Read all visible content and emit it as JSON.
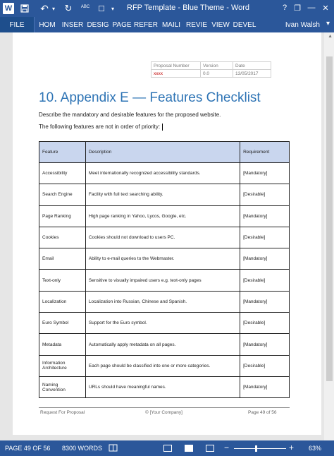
{
  "window": {
    "title": "RFP Template - Blue Theme - Word",
    "help_icon": "?",
    "minimize_icon": "—",
    "restore_icon": "❐",
    "close_icon": "✕"
  },
  "quick_access": {
    "app_icon": "W",
    "save_icon": "💾",
    "undo_icon": "↶",
    "undo_menu_icon": "▾",
    "redo_icon": "↻",
    "spelling_icon": "ABC",
    "format_icon": "☐",
    "more_icon": "▾"
  },
  "ribbon": {
    "tabs": [
      {
        "label": "FILE"
      },
      {
        "label": "HOM"
      },
      {
        "label": "INSER"
      },
      {
        "label": "DESIG"
      },
      {
        "label": "PAGE"
      },
      {
        "label": "REFER"
      },
      {
        "label": "MAILI"
      },
      {
        "label": "REVIE"
      },
      {
        "label": "VIEW"
      },
      {
        "label": "DEVEL"
      }
    ],
    "user": "Ivan Walsh",
    "user_caret": "▾"
  },
  "header_table": {
    "labels": [
      "Proposal Number",
      "Version",
      "Date"
    ],
    "values": [
      "xxxx",
      "0.0",
      "13/05/2017"
    ]
  },
  "document": {
    "heading": "10. Appendix E — Features Checklist",
    "intro": "Describe the mandatory and desirable features for the proposed website.",
    "note": "The following features are not in order of priority:"
  },
  "features_table": {
    "headers": [
      "Feature",
      "Description",
      "Requirement"
    ],
    "rows": [
      {
        "feature": "Accessibility",
        "description": "Meet internationally recognized accessibility standards.",
        "requirement": "[Mandatory]"
      },
      {
        "feature": "Search Engine",
        "description": "Facility with full text searching ability.",
        "requirement": "[Desirable]"
      },
      {
        "feature": "Page Ranking",
        "description": "High page ranking in Yahoo, Lycos, Google, etc.",
        "requirement": "[Mandatory]"
      },
      {
        "feature": "Cookies",
        "description": "Cookies should not download to users PC.",
        "requirement": "[Desirable]"
      },
      {
        "feature": "Email",
        "description": "Ability to e-mail queries to the Webmaster.",
        "requirement": "[Mandatory]"
      },
      {
        "feature": "Text-only",
        "description": "Sensitive to visually impaired users e.g. text-only pages",
        "requirement": "[Desirable]"
      },
      {
        "feature": "Localization",
        "description": "Localization into Russian, Chinese and Spanish.",
        "requirement": "[Mandatory]"
      },
      {
        "feature": "Euro Symbol",
        "description": "Support for the Euro symbol.",
        "requirement": "[Desirable]"
      },
      {
        "feature": "Metadata",
        "description": "Automatically apply metadata on all pages.",
        "requirement": "[Mandatory]"
      },
      {
        "feature": "Information Architecture",
        "description": "Each page should be classified into one or more categories.",
        "requirement": "[Desirable]"
      },
      {
        "feature": "Naming Convention",
        "description": "URLs should have meaningful names.",
        "requirement": "[Mandatory]"
      }
    ]
  },
  "footer": {
    "left": "Request For Proposal",
    "center": "© [Your Company]",
    "right": "Page 49 of 56"
  },
  "status_bar": {
    "page": "PAGE 49 OF 56",
    "words": "8300 WORDS",
    "proofing_icon": "📖",
    "zoom_out": "−",
    "zoom_in": "+",
    "zoom": "63%"
  }
}
